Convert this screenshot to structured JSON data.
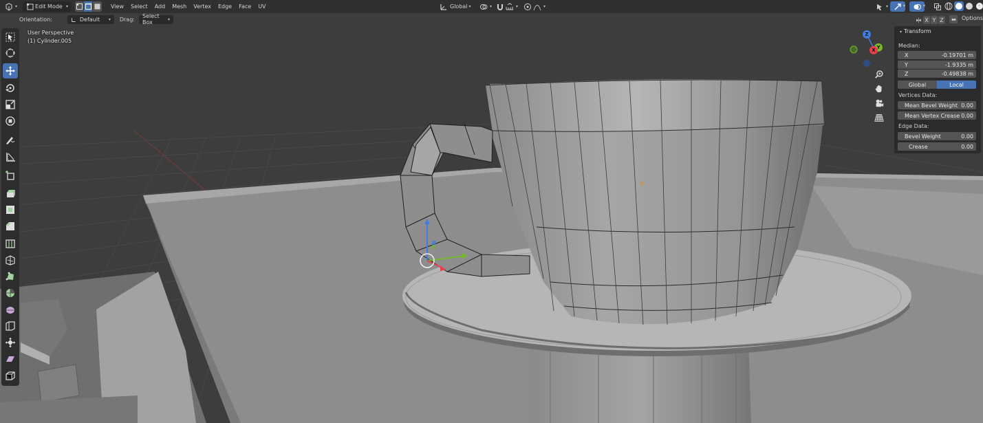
{
  "header": {
    "mode": "Edit Mode",
    "menus": [
      "View",
      "Select",
      "Add",
      "Mesh",
      "Vertex",
      "Edge",
      "Face",
      "UV"
    ],
    "transform_orientation": "Global"
  },
  "tool_settings": {
    "orientation_label": "Orientation:",
    "orientation_value": "Default",
    "drag_label": "Drag:",
    "drag_value": "Select Box",
    "axis_labels": [
      "X",
      "Y",
      "Z"
    ],
    "options_label": "Options"
  },
  "viewport": {
    "view_name": "User Perspective",
    "object_name": "(1) Cylinder.005"
  },
  "nav_gizmo": {
    "axis_x": "X",
    "axis_y": "Y",
    "axis_z": "Z"
  },
  "npanel": {
    "title": "Transform",
    "median_label": "Median:",
    "x_label": "X",
    "x_value": "-0.19701 m",
    "y_label": "Y",
    "y_value": "-1.9335 m",
    "z_label": "Z",
    "z_value": "-0.49838 m",
    "space_global": "Global",
    "space_local": "Local",
    "vertices_label": "Vertices Data:",
    "mean_bevel_label": "Mean Bevel Weight",
    "mean_bevel_value": "0.00",
    "mean_crease_label": "Mean Vertex Crease",
    "mean_crease_value": "0.00",
    "edge_label": "Edge Data:",
    "bevel_label": "Bevel Weight",
    "bevel_value": "0.00",
    "crease_label": "Crease",
    "crease_value": "0.00"
  },
  "colors": {
    "accent": "#4772b3",
    "background": "#3d3d3d",
    "header": "#303030",
    "panel": "#2b2b2b",
    "field": "#545454",
    "axis_x": "#e8414e",
    "axis_y": "#77b82d",
    "axis_z": "#3f7ee0"
  }
}
